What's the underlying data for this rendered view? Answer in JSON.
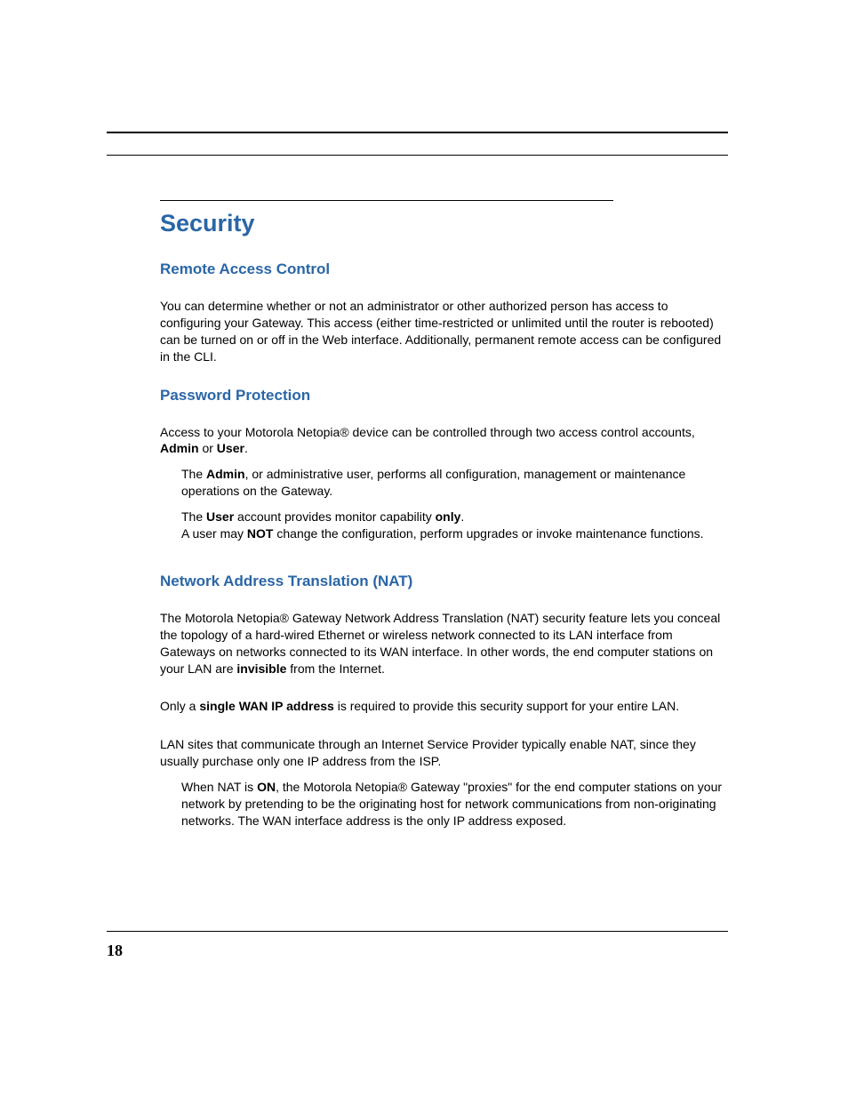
{
  "page_number": "18",
  "chapter_title": "Security",
  "sections": {
    "remote_access": {
      "heading": "Remote Access Control",
      "body": "You can determine whether or not an administrator or other authorized person has access to configuring your Gateway. This access (either time-restricted or unlimited until the router is rebooted) can be turned on or off in the Web interface. Additionally, permanent remote access can be configured in the CLI."
    },
    "password_protection": {
      "heading": "Password Protection",
      "intro_pre": "Access to your Motorola Netopia® device can be controlled through two access control accounts, ",
      "intro_b1": "Admin",
      "intro_mid": " or ",
      "intro_b2": "User",
      "intro_post": ".",
      "admin_pre": "The ",
      "admin_b": "Admin",
      "admin_post": ", or administrative user, performs all configuration, management or maintenance operations on the Gateway.",
      "user_pre": "The ",
      "user_b1": "User",
      "user_mid1": " account provides monitor capability ",
      "user_b2": "only",
      "user_post1": ".",
      "user_line2_pre": "A user may ",
      "user_line2_b": "NOT",
      "user_line2_post": " change the configuration, perform upgrades or invoke maintenance functions."
    },
    "nat": {
      "heading": "Network Address Translation (NAT)",
      "p1_pre": "The Motorola Netopia® Gateway Network Address Translation (NAT) security feature lets you conceal the topology of a hard-wired Ethernet or wireless network connected to its LAN interface from Gateways on networks connected to its WAN interface. In other words, the end computer stations on your LAN are ",
      "p1_b": "invisible",
      "p1_post": " from the Internet.",
      "p2_pre": "Only a ",
      "p2_b": "single WAN IP address",
      "p2_post": " is required to provide this security support for your entire LAN.",
      "p3": "LAN sites that communicate through an Internet Service Provider typically enable NAT, since they usually purchase only one IP address from the ISP.",
      "p4_pre": "When NAT is ",
      "p4_b": "ON",
      "p4_post": ", the Motorola Netopia® Gateway \"proxies\" for the end computer stations on your network by pretending to be the originating host for network communications from non-originating networks. The WAN interface address is the only IP address exposed."
    }
  }
}
